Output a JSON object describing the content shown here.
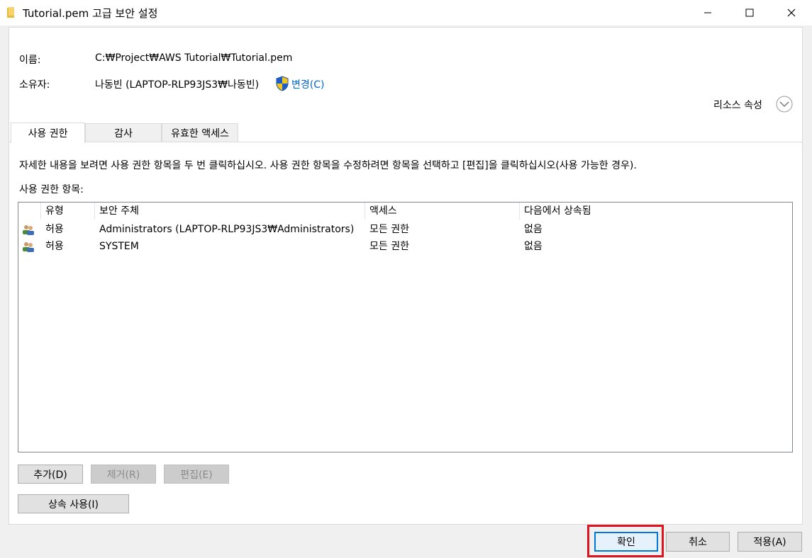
{
  "window": {
    "title": "Tutorial.pem 고급 보안 설정"
  },
  "fields": {
    "name_label": "이름:",
    "name_value": "C:₩Project₩AWS Tutorial₩Tutorial.pem",
    "owner_label": "소유자:",
    "owner_value": "나동빈 (LAPTOP-RLP93JS3₩나동빈)",
    "change_link": "변경(C)"
  },
  "resource_props": "리소스 속성",
  "tabs": [
    {
      "label": "사용 권한",
      "active": true
    },
    {
      "label": "감사",
      "active": false
    },
    {
      "label": "유효한 액세스",
      "active": false
    }
  ],
  "instructions": "자세한 내용을 보려면 사용 권한 항목을 두 번 클릭하십시오. 사용 권한 항목을 수정하려면 항목을 선택하고 [편집]을 클릭하십시오(사용 가능한 경우).",
  "entries_label": "사용 권한 항목:",
  "table": {
    "columns": [
      "유형",
      "보안 주체",
      "액세스",
      "다음에서 상속됨"
    ],
    "rows": [
      {
        "type": "허용",
        "principal": "Administrators (LAPTOP-RLP93JS3₩Administrators)",
        "access": "모든 권한",
        "inherited": "없음"
      },
      {
        "type": "허용",
        "principal": "SYSTEM",
        "access": "모든 권한",
        "inherited": "없음"
      }
    ]
  },
  "buttons": {
    "add": "추가(D)",
    "remove": "제거(R)",
    "edit": "편집(E)",
    "inherit": "상속 사용(I)",
    "ok": "확인",
    "cancel": "취소",
    "apply": "적용(A)"
  },
  "colors": {
    "link": "#0066cc",
    "highlight": "#e0141e",
    "primary_border": "#0078d7"
  }
}
